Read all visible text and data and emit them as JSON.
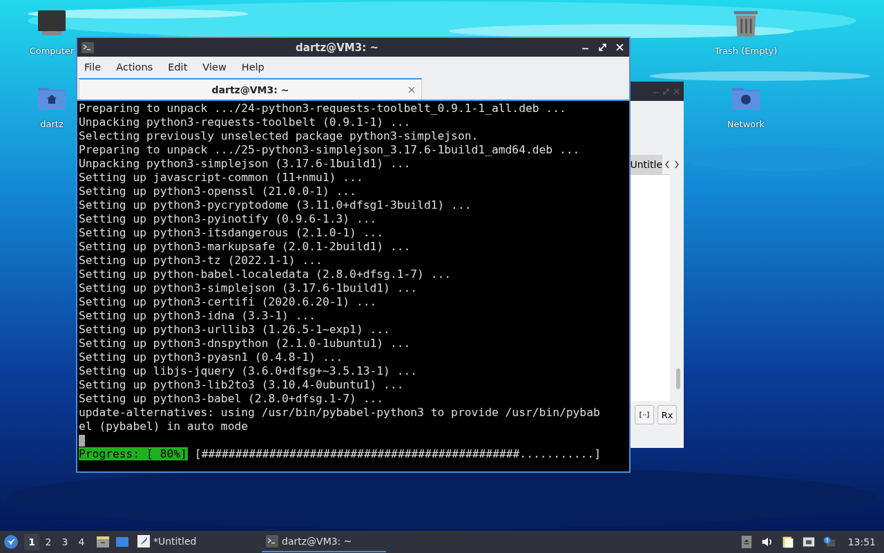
{
  "desktop_icons": [
    {
      "label": "Computer",
      "kind": "computer"
    },
    {
      "label": "dartz",
      "kind": "home"
    },
    {
      "label": "Trash (Empty)",
      "kind": "trash"
    },
    {
      "label": "Network",
      "kind": "network"
    }
  ],
  "background_window": {
    "tab_label": "Untitle",
    "tool_buttons": [
      {
        "kind": "icon"
      },
      {
        "kind": "text",
        "label": "Rx"
      }
    ]
  },
  "terminal": {
    "title": "dartz@VM3: ~",
    "menu": [
      "File",
      "Actions",
      "Edit",
      "View",
      "Help"
    ],
    "tabs": [
      {
        "label": "dartz@VM3: ~",
        "selected": true
      }
    ],
    "lines": [
      "Preparing to unpack .../24-python3-requests-toolbelt_0.9.1-1_all.deb ...",
      "Unpacking python3-requests-toolbelt (0.9.1-1) ...",
      "Selecting previously unselected package python3-simplejson.",
      "Preparing to unpack .../25-python3-simplejson_3.17.6-1build1_amd64.deb ...",
      "Unpacking python3-simplejson (3.17.6-1build1) ...",
      "Setting up javascript-common (11+nmu1) ...",
      "Setting up python3-openssl (21.0.0-1) ...",
      "Setting up python3-pycryptodome (3.11.0+dfsg1-3build1) ...",
      "Setting up python3-pyinotify (0.9.6-1.3) ...",
      "Setting up python3-itsdangerous (2.1.0-1) ...",
      "Setting up python3-markupsafe (2.0.1-2build1) ...",
      "Setting up python3-tz (2022.1-1) ...",
      "Setting up python-babel-localedata (2.8.0+dfsg.1-7) ...",
      "Setting up python3-simplejson (3.17.6-1build1) ...",
      "Setting up python3-certifi (2020.6.20-1) ...",
      "Setting up python3-idna (3.3-1) ...",
      "Setting up python3-urllib3 (1.26.5-1~exp1) ...",
      "Setting up python3-dnspython (2.1.0-1ubuntu1) ...",
      "Setting up python3-pyasn1 (0.4.8-1) ...",
      "Setting up libjs-jquery (3.6.0+dfsg+~3.5.13-1) ...",
      "Setting up python3-lib2to3 (3.10.4-0ubuntu1) ...",
      "Setting up python3-babel (2.8.0+dfsg.1-7) ...",
      "update-alternatives: using /usr/bin/pybabel-python3 to provide /usr/bin/pybab",
      "el (pybabel) in auto mode"
    ],
    "progress_label": "Progress: [ 80%]",
    "progress_bar": "[###############################################...........]"
  },
  "taskbar": {
    "workspaces": [
      {
        "label": "1",
        "selected": true
      },
      {
        "label": "2",
        "selected": false
      },
      {
        "label": "3",
        "selected": false
      },
      {
        "label": "4",
        "selected": false
      }
    ],
    "tasks": [
      {
        "label": "*Untitled",
        "kind": "editor",
        "selected": false
      },
      {
        "label": "dartz@VM3: ~",
        "kind": "terminal",
        "selected": true
      }
    ],
    "clock": "13:51"
  }
}
